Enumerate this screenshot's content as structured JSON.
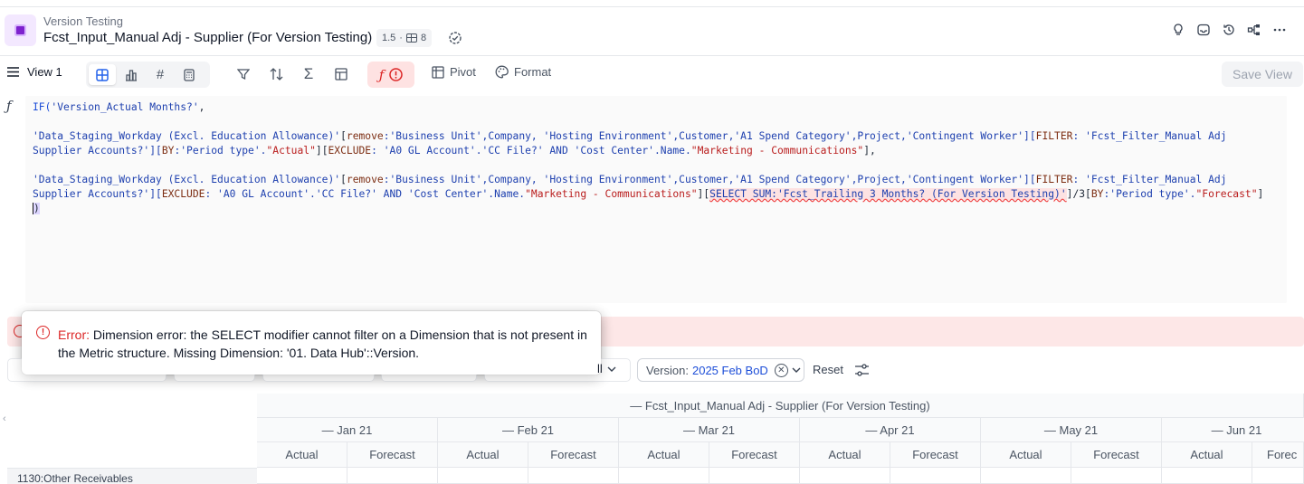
{
  "header": {
    "breadcrumb": "Version Testing",
    "title": "Fcst_Input_Manual Adj - Supplier (For Version Testing)",
    "version_number": "1.5",
    "separator": "·",
    "dimension_count": "8"
  },
  "toolbar": {
    "view_label": "View 1",
    "pivot_label": "Pivot",
    "format_label": "Format",
    "save_view_label": "Save View"
  },
  "formula": {
    "gutter": "ƒ",
    "l1": "IF(",
    "l1b": "'Version_Actual Months?'",
    "l1c": ",",
    "p1a": "'Data_Staging_Workday (Excl. Education Allowance)'",
    "p1b": "[",
    "p1c": "remove",
    "p1d": ":'Business Unit',Company, 'Hosting Environment',Customer,'A1 Spend Category',Project,'Contingent Worker'][",
    "p1e": "FILTER",
    "p1f": ": 'Fcst_Filter_Manual Adj Supplier Accounts?'][",
    "p1g": "BY",
    "p1h": ":'Period type'.",
    "p1i": "\"Actual\"",
    "p1j": "][",
    "p1k": "EXCLUDE",
    "p1l": ": 'A0 GL Account'.'CC File?' AND 'Cost Center'.Name.",
    "p1m": "\"Marketing - Communications\"",
    "p1n": "],",
    "p2a": "'Data_Staging_Workday (Excl. Education Allowance)'",
    "p2b": "[",
    "p2c": "remove",
    "p2d": ":'Business Unit',Company, 'Hosting Environment',Customer,'A1 Spend Category',Project,'Contingent Worker'][",
    "p2e": "FILTER",
    "p2f": ": 'Fcst_Filter_Manual Adj Supplier Accounts?'][",
    "p2g": "EXCLUDE",
    "p2h": ": 'A0 GL Account'.'CC File?' AND 'Cost Center'.Name.",
    "p2i": "\"Marketing - Communications\"",
    "p2j": "][",
    "p2k": "SELECT SUM:'Fcst_Trailing 3 Months? (For Version Testing)'",
    "p2l": "]/3[",
    "p2m": "BY",
    "p2n": ":'Period type'.",
    "p2o": "\"Forecast\"",
    "p2p": "]",
    "close": ")"
  },
  "error": {
    "label": "Error:",
    "message": "Dimension error: the SELECT modifier cannot filter on a Dimension that is not present in the Metric structure. Missing Dimension: '01. Data Hub'::Version."
  },
  "filters": {
    "dropdown_tail": "ll",
    "version_label": "Version:",
    "version_value": "2025 Feb BoD",
    "reset_label": "Reset"
  },
  "grid": {
    "metric_header": "— Fcst_Input_Manual Adj - Supplier (For Version Testing)",
    "months": [
      "— Jan 21",
      "— Feb 21",
      "— Mar 21",
      "— Apr 21",
      "— May 21",
      "— Jun 21"
    ],
    "sub_actual": "Actual",
    "sub_forecast": "Forecast",
    "sub_forecast_clipped": "Forec",
    "row_label": "1130:Other Receivables"
  }
}
